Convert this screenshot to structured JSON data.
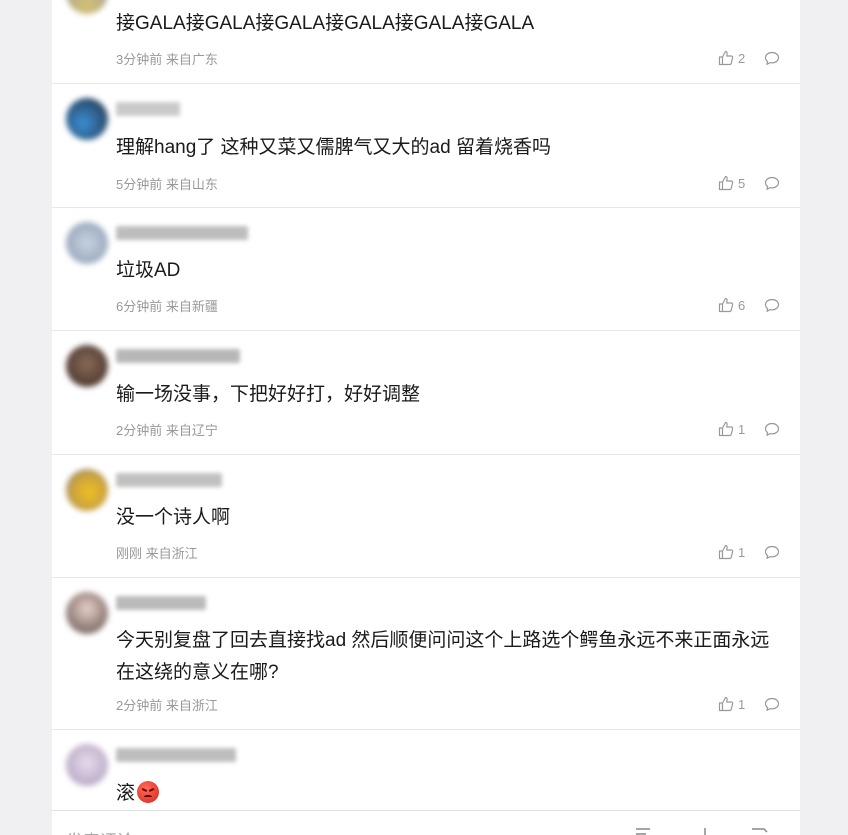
{
  "comments": [
    {
      "text": "接GALA接GALA接GALA接GALA接GALA接GALA",
      "meta": "3分钟前 来自广东",
      "likes": "2"
    },
    {
      "text": "理解hang了 这种又菜又儒脾气又大的ad 留着烧香吗",
      "meta": "5分钟前 来自山东",
      "likes": "5"
    },
    {
      "text": "垃圾AD",
      "meta": "6分钟前 来自新疆",
      "likes": "6"
    },
    {
      "text": "输一场没事，下把好好打，好好调整",
      "meta": "2分钟前 来自辽宁",
      "likes": "1"
    },
    {
      "text": "没一个诗人啊",
      "meta": "刚刚 来自浙江",
      "likes": "1"
    },
    {
      "text": "今天别复盘了回去直接找ad 然后顺便问问这个上路选个鳄鱼永远不来正面永远在这绕的意义在哪?",
      "meta": "2分钟前 来自浙江",
      "likes": "1"
    },
    {
      "text": "滚"
    }
  ],
  "composer": {
    "placeholder": "发表评论"
  },
  "icons": {
    "like": "thumbs-up-icon",
    "reply": "comment-bubble-icon",
    "emoji": "angry-face-emoji-icon",
    "edit": "edit-icon",
    "share": "share-icon"
  },
  "colors": {
    "meta": "#999999",
    "text": "#1a1a1a",
    "background": "#f0f0f2",
    "card": "#ffffff"
  }
}
